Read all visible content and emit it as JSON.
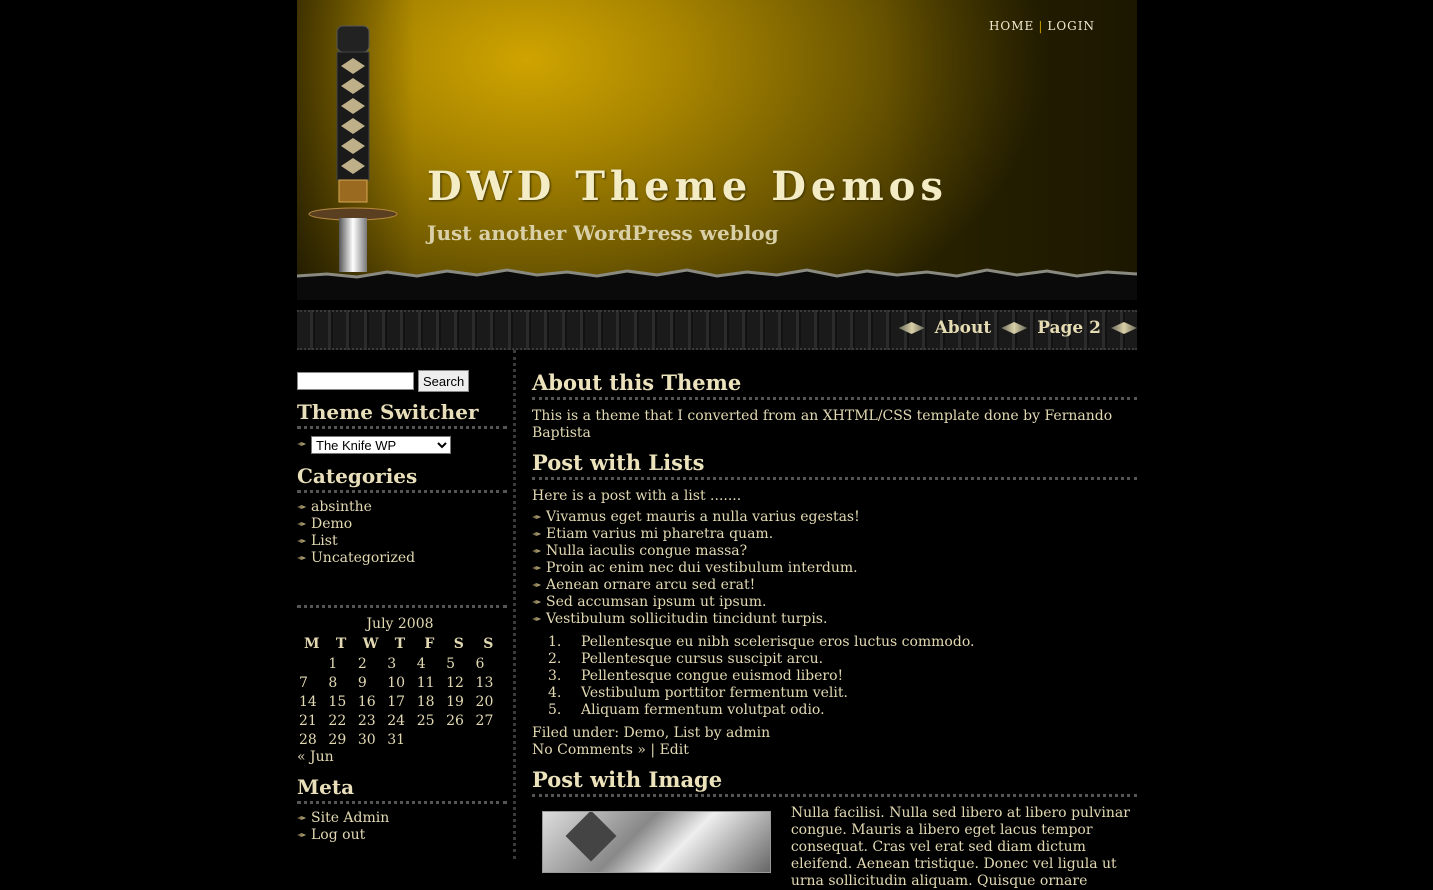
{
  "header": {
    "title": "DWD Theme Demos",
    "description": "Just another WordPress weblog",
    "top_links": [
      "HOME",
      "LOGIN"
    ],
    "separator": "|"
  },
  "nav": {
    "items": [
      "About",
      "Page 2"
    ]
  },
  "sidebar": {
    "search": {
      "value": "",
      "button_label": "Search"
    },
    "theme_switcher": {
      "title": "Theme Switcher",
      "selected": "The Knife WP"
    },
    "categories": {
      "title": "Categories",
      "items": [
        "absinthe",
        "Demo",
        "List",
        "Uncategorized"
      ]
    },
    "calendar": {
      "caption": "July 2008",
      "headers": [
        "M",
        "T",
        "W",
        "T",
        "F",
        "S",
        "S"
      ],
      "weeks": [
        [
          "",
          "1",
          "2",
          "3",
          "4",
          "5",
          "6"
        ],
        [
          "7",
          "8",
          "9",
          "10",
          "11",
          "12",
          "13"
        ],
        [
          "14",
          "15",
          "16",
          "17",
          "18",
          "19",
          "20"
        ],
        [
          "21",
          "22",
          "23",
          "24",
          "25",
          "26",
          "27"
        ],
        [
          "28",
          "29",
          "30",
          "31",
          "",
          "",
          ""
        ]
      ],
      "prev_link": "« Jun"
    },
    "meta": {
      "title": "Meta",
      "items": [
        "Site Admin",
        "Log out"
      ]
    }
  },
  "posts": {
    "about": {
      "title": "About this Theme",
      "text": "This is a theme that I converted from an XHTML/CSS template done by Fernando Baptista"
    },
    "lists": {
      "title": "Post with Lists",
      "intro": "Here is a post with a list .......",
      "bullets": [
        "Vivamus eget mauris a nulla varius egestas!",
        "Etiam varius mi pharetra quam.",
        "Nulla iaculis congue massa?",
        "Proin ac enim nec dui vestibulum interdum.",
        "Aenean ornare arcu sed erat!",
        "Sed accumsan ipsum ut ipsum.",
        "Vestibulum sollicitudin tincidunt turpis."
      ],
      "numbered": [
        "Pellentesque eu nibh scelerisque eros luctus commodo.",
        "Pellentesque cursus suscipit arcu.",
        "Pellentesque congue euismod libero!",
        "Vestibulum porttitor fermentum velit.",
        "Aliquam fermentum volutpat odio."
      ],
      "meta": {
        "filed_prefix": "Filed under: ",
        "cat1": "Demo",
        "comma": ", ",
        "cat2": "List",
        "by": " by admin",
        "comments": "No Comments »",
        "pipe": " | ",
        "edit": "Edit"
      }
    },
    "image": {
      "title": "Post with Image",
      "text": "Nulla facilisi. Nulla sed libero at libero pulvinar congue. Mauris a libero eget lacus tempor consequat. Cras vel erat sed diam dictum eleifend. Aenean tristique. Donec vel ligula ut urna sollicitudin aliquam. Quisque ornare"
    }
  },
  "colors": {
    "accent": "#c8a000",
    "text": "#e2d9b2",
    "background": "#000000"
  }
}
